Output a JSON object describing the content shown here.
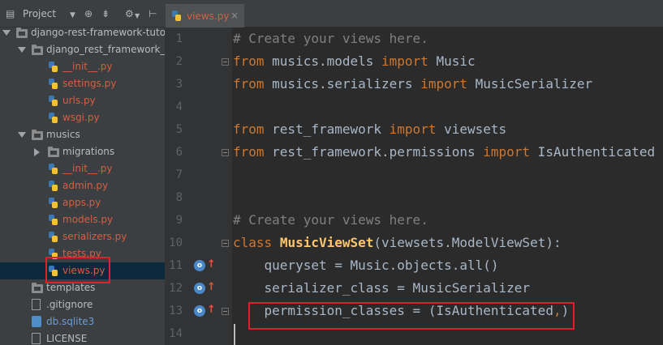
{
  "project_panel": {
    "title": "Project",
    "icons": [
      "dropdown-caret-icon",
      "target-icon",
      "collapse-all-icon",
      "settings-icon",
      "hide-panel-icon"
    ],
    "tree": [
      {
        "label": "django-rest-framework-tutor",
        "type": "folder",
        "depth": 0,
        "expanded": true,
        "color": "plain"
      },
      {
        "label": "django_rest_framework_tutorial",
        "type": "folder",
        "depth": 1,
        "expanded": true,
        "color": "plain"
      },
      {
        "label": "__init__.py",
        "type": "py",
        "depth": 2,
        "color": "red"
      },
      {
        "label": "settings.py",
        "type": "py",
        "depth": 2,
        "color": "red"
      },
      {
        "label": "urls.py",
        "type": "py",
        "depth": 2,
        "color": "red"
      },
      {
        "label": "wsgi.py",
        "type": "py",
        "depth": 2,
        "color": "red"
      },
      {
        "label": "musics",
        "type": "folder",
        "depth": 1,
        "expanded": true,
        "color": "plain"
      },
      {
        "label": "migrations",
        "type": "folder",
        "depth": 2,
        "expanded": false,
        "color": "plain"
      },
      {
        "label": "__init__.py",
        "type": "py",
        "depth": 2,
        "color": "red"
      },
      {
        "label": "admin.py",
        "type": "py",
        "depth": 2,
        "color": "red"
      },
      {
        "label": "apps.py",
        "type": "py",
        "depth": 2,
        "color": "red"
      },
      {
        "label": "models.py",
        "type": "py",
        "depth": 2,
        "color": "red"
      },
      {
        "label": "serializers.py",
        "type": "py",
        "depth": 2,
        "color": "red"
      },
      {
        "label": "tests.py",
        "type": "py",
        "depth": 2,
        "color": "red"
      },
      {
        "label": "views.py",
        "type": "py",
        "depth": 2,
        "color": "red",
        "selected": true
      },
      {
        "label": "templates",
        "type": "folder",
        "depth": 1,
        "color": "plain"
      },
      {
        "label": ".gitignore",
        "type": "file",
        "depth": 1,
        "color": "plain"
      },
      {
        "label": "db.sqlite3",
        "type": "db",
        "depth": 1,
        "color": "blue"
      },
      {
        "label": "LICENSE",
        "type": "file",
        "depth": 1,
        "color": "plain"
      }
    ]
  },
  "editor": {
    "tab": {
      "label": "views.py",
      "close": "×"
    },
    "line_numbers": [
      "1",
      "2",
      "3",
      "4",
      "5",
      "6",
      "7",
      "8",
      "9",
      "10",
      "11",
      "12",
      "13",
      "14"
    ],
    "override_marker": "o",
    "override_arrow": "↑",
    "lines": [
      [
        {
          "t": "# Create your views here.",
          "c": "cm"
        }
      ],
      [
        {
          "t": "from",
          "c": "kw"
        },
        {
          "t": " musics.models ",
          "c": "tx"
        },
        {
          "t": "import",
          "c": "kw"
        },
        {
          "t": " Music",
          "c": "tx"
        }
      ],
      [
        {
          "t": "from",
          "c": "kw"
        },
        {
          "t": " musics.serializers ",
          "c": "tx"
        },
        {
          "t": "import",
          "c": "kw"
        },
        {
          "t": " MusicSerializer",
          "c": "tx"
        }
      ],
      [],
      [
        {
          "t": "from",
          "c": "kw"
        },
        {
          "t": " rest_framework ",
          "c": "tx"
        },
        {
          "t": "import",
          "c": "kw"
        },
        {
          "t": " viewsets",
          "c": "tx"
        }
      ],
      [
        {
          "t": "from",
          "c": "kw"
        },
        {
          "t": " rest_framework.permissions ",
          "c": "tx"
        },
        {
          "t": "import",
          "c": "kw"
        },
        {
          "t": " IsAuthenticated",
          "c": "tx"
        }
      ],
      [],
      [],
      [
        {
          "t": "# Create your views here.",
          "c": "cm"
        }
      ],
      [
        {
          "t": "class",
          "c": "kw"
        },
        {
          "t": " ",
          "c": "tx"
        },
        {
          "t": "MusicViewSet",
          "c": "cls"
        },
        {
          "t": "(viewsets.ModelViewSet):",
          "c": "tx"
        }
      ],
      [
        {
          "t": "    queryset = Music.objects.all()",
          "c": "tx"
        }
      ],
      [
        {
          "t": "    serializer_class = MusicSerializer",
          "c": "tx"
        }
      ],
      [
        {
          "t": "    permission_classes = (IsAuthenticated",
          "c": "tx"
        },
        {
          "t": ",",
          "c": "kw"
        },
        {
          "t": ")",
          "c": "tx"
        }
      ],
      []
    ]
  },
  "colors": {
    "highlight_box": "#e0202c",
    "keyword": "#cc7832",
    "comment": "#808080",
    "class_name": "#ffc66d",
    "file_modified": "#d45f43"
  }
}
